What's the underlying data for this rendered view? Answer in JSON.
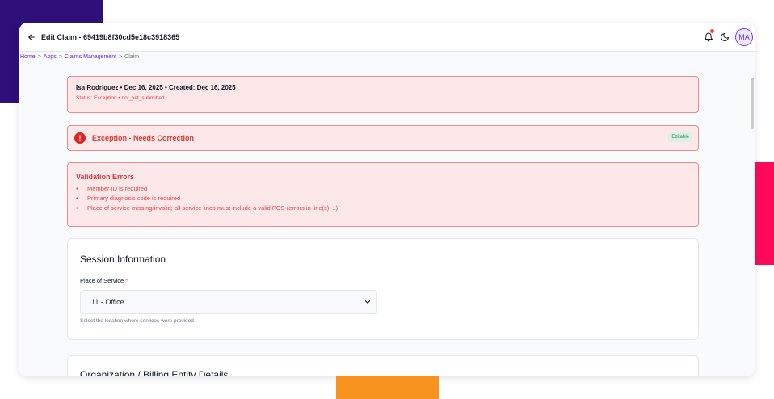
{
  "header": {
    "title": "Edit Claim - 69419b8f30cd5e18c3918365",
    "avatar_initials": "MA",
    "icons": [
      "arrow-left-icon",
      "bell-icon",
      "moon-icon"
    ]
  },
  "breadcrumb": {
    "items": [
      "Home",
      "Apps",
      "Claims Management",
      "Claim"
    ],
    "separator": ">"
  },
  "summary": {
    "title": "Isa Rodriguez • Dec 16, 2025 • Created: Dec 16, 2025",
    "status": "Status: Exception • not_yet_submitted"
  },
  "exception": {
    "icon_text": "!",
    "title": "Exception - Needs Correction",
    "badge": "Editable"
  },
  "validation": {
    "title": "Validation Errors",
    "errors": [
      "Member ID is required",
      "Primary diagnosis code is required",
      "Place of service missing/invalid; all service lines must include a valid POS (errors in line(s): 1)"
    ]
  },
  "session": {
    "title": "Session Information",
    "field_label": "Place of Service",
    "required_mark": "*",
    "selected_value": "11 - Office",
    "hint": "Select the location where services were provided"
  },
  "organization": {
    "title": "Organization / Billing Entity Details"
  },
  "colors": {
    "accent": "#7c3aed",
    "error": "#dc2626",
    "error_bg": "#fce8e8",
    "success_badge": "#2e8b57",
    "deco_purple": "#2e0f7a",
    "deco_pink": "#ff0a5a",
    "deco_orange": "#f7931e"
  }
}
